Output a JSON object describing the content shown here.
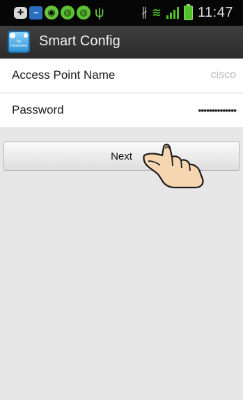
{
  "status_bar": {
    "time": "11:47",
    "notification_icons": [
      "plus-icon",
      "blackberry-icon",
      "camera-icon",
      "messenger-icon",
      "chat-icon",
      "usb-icon"
    ],
    "system_icons": [
      "bluetooth-icon",
      "wifi-icon",
      "signal-icon",
      "battery-icon"
    ]
  },
  "action_bar": {
    "title": "Smart Config",
    "app_icon": "my-homeview-icon",
    "app_icon_text_1": "My",
    "app_icon_text_2": "HomeView"
  },
  "form": {
    "access_point_label": "Access Point Name",
    "access_point_value": "cisco",
    "password_label": "Password",
    "password_value": "••••••••••••••"
  },
  "next_button": {
    "label": "Next"
  },
  "colors": {
    "status_bar_bg": "#060606",
    "action_bar_bg": "#333333",
    "screen_bg": "#e7e7e7",
    "accent_green": "#4fc227"
  }
}
